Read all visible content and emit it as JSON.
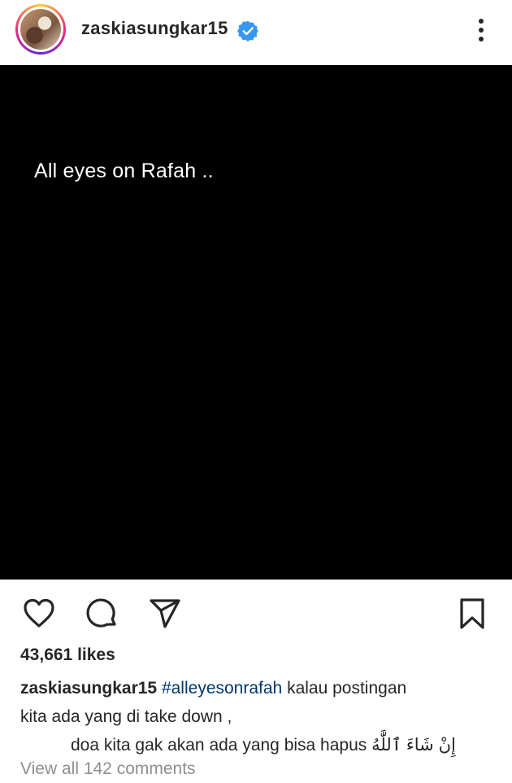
{
  "header": {
    "username": "zaskiasungkar15",
    "verified": true,
    "avatar_icon": "profile-photo",
    "more_icon": "more-vertical-icon"
  },
  "post": {
    "text": "All eyes on Rafah .."
  },
  "actions": {
    "like_icon": "heart-icon",
    "comment_icon": "comment-icon",
    "share_icon": "send-icon",
    "save_icon": "bookmark-icon"
  },
  "likes": "43,661 likes",
  "caption": {
    "username": "zaskiasungkar15",
    "hashtag": "#alleyesonrafah",
    "line1_rest": " kalau postingan",
    "line2": "kita ada yang di take down ,",
    "line3": "doa kita gak akan ada yang bisa hapus",
    "arabic": "إِنْ شَاءَ ٱللَّٰهُ"
  },
  "comments_link": "View all 142 comments",
  "colors": {
    "link": "#00376b",
    "verified": "#3897f0",
    "muted": "#8e8e8e",
    "text": "#262626"
  }
}
